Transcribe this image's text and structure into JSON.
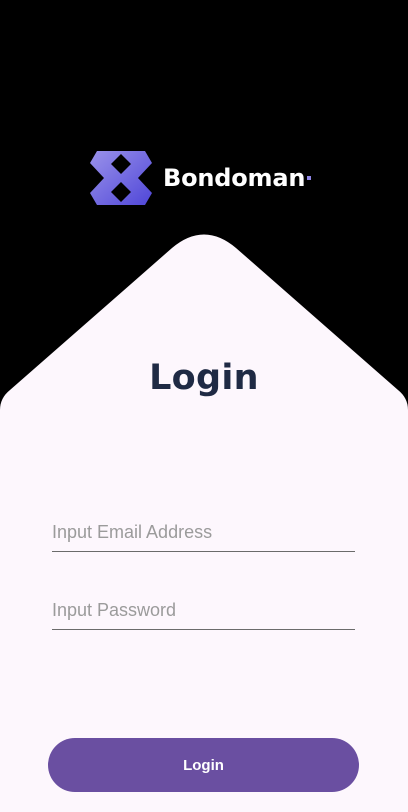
{
  "brand": {
    "name": "Bondoman",
    "logo_icon": "bondoman-logo-icon",
    "accent_dot_color": "#8f86e6"
  },
  "login": {
    "title": "Login",
    "email": {
      "placeholder": "Input Email Address",
      "value": ""
    },
    "password": {
      "placeholder": "Input Password",
      "value": ""
    },
    "submit_label": "Login"
  },
  "colors": {
    "background": "#000000",
    "card": "#fdf7fd",
    "title": "#1f2a44",
    "button": "#6a4fa1",
    "button_text": "#ffffff",
    "logo_gradient_start": "#9a92ea",
    "logo_gradient_end": "#4f46d8"
  }
}
